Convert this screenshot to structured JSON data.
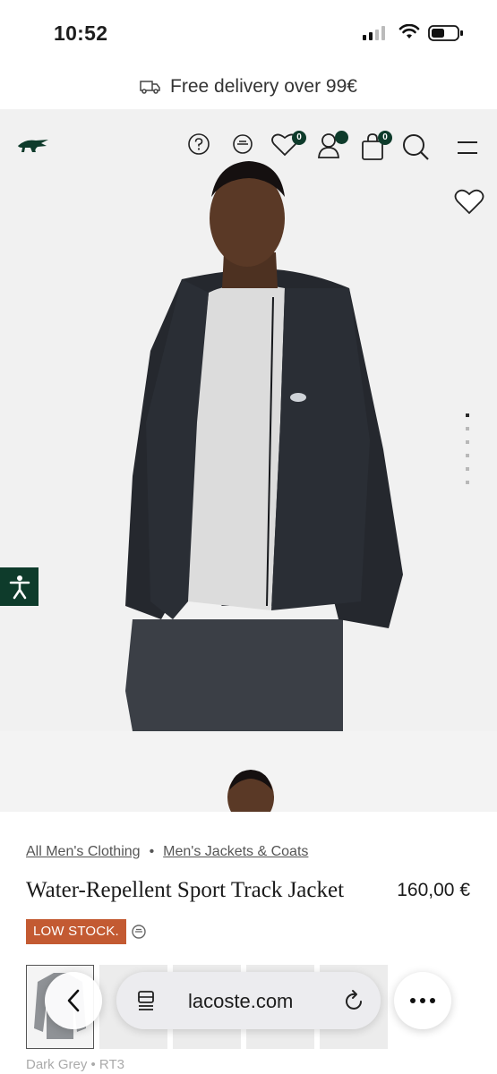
{
  "status_bar": {
    "time": "10:52"
  },
  "promo": {
    "text": "Free delivery over 99€"
  },
  "header": {
    "wishlist_count": "0",
    "cart_count": "0"
  },
  "gallery": {
    "total_images": 6,
    "active_index": 0
  },
  "product": {
    "breadcrumbs": [
      "All Men's Clothing",
      "Men's Jackets & Coats"
    ],
    "breadcrumb_separator": "•",
    "title": "Water-Repellent Sport Track Jacket",
    "price": "160,00 €",
    "stock_badge": "LOW STOCK.",
    "selected_color_label": "Dark Grey • RT3"
  },
  "browser": {
    "url": "lacoste.com"
  },
  "colors": {
    "brand_green": "#0e3b2b",
    "low_stock": "#c35a32"
  }
}
